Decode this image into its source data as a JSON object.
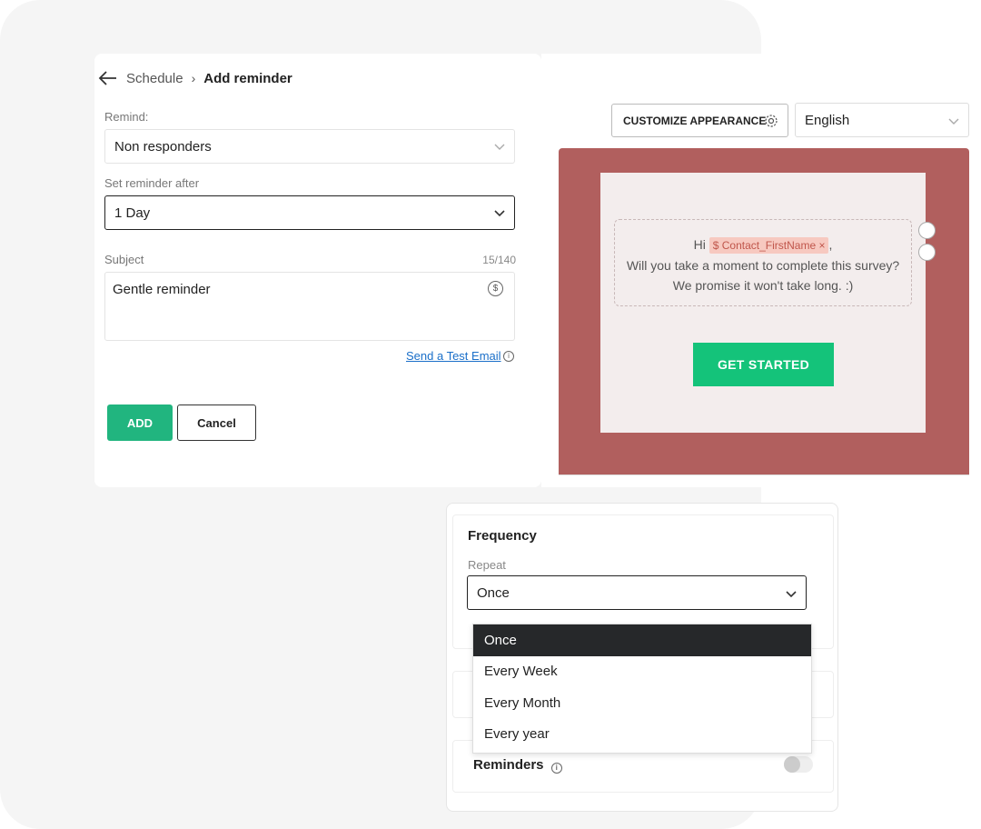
{
  "breadcrumb": {
    "parent": "Schedule",
    "current": "Add reminder"
  },
  "remind": {
    "label": "Remind:",
    "value": "Non responders"
  },
  "reminder_after": {
    "label": "Set reminder after",
    "value": "1 Day"
  },
  "subject": {
    "label": "Subject",
    "counter": "15/140",
    "value": "Gentle reminder"
  },
  "test_email_link": "Send a Test Email",
  "buttons": {
    "add": "ADD",
    "cancel": "Cancel"
  },
  "preview": {
    "customize_label": "CUSTOMIZE APPEARANCE",
    "language": "English",
    "greeting": "Hi",
    "tag": "$ Contact_FirstName",
    "tag_close": "×",
    "comma": ",",
    "line2": "Will you take a moment to complete this survey?",
    "line3": "We promise it won't take long. :)",
    "cta": "GET STARTED",
    "bg_color": "#b15f5e",
    "cta_color": "#14c37a"
  },
  "frequency": {
    "title": "Frequency",
    "repeat_label": "Repeat",
    "repeat_value": "Once",
    "options": [
      "Once",
      "Every Week",
      "Every Month",
      "Every year"
    ]
  },
  "reminders": {
    "title": "Reminders",
    "enabled": false
  },
  "colors": {
    "accent": "#21b57f",
    "link": "#1a6fc9"
  }
}
